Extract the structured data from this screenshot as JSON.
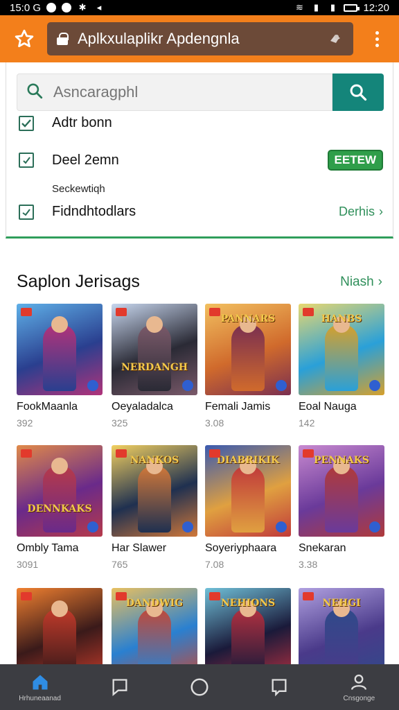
{
  "status_bar": {
    "time": "15:0 G",
    "clock": "12:20"
  },
  "app_bar": {
    "url": "Aplkxulaplikr Apdengnla"
  },
  "search": {
    "placeholder": "Asncaragphl"
  },
  "options": [
    {
      "label": "Adtr bonn"
    },
    {
      "label": "Deel 2emn",
      "badge": "EETEW"
    },
    {
      "label": "Fidndhtodlars",
      "link": "Derhis"
    }
  ],
  "options_small": "Seckewtiqh",
  "section": {
    "title": "Saplon Jerisags",
    "more": "Niash"
  },
  "games": [
    {
      "title": "FookMaanla",
      "num": "392",
      "colors": [
        "#2a3f8f",
        "#b1337a",
        "#5fb0e8"
      ]
    },
    {
      "title": "Oeyaladalca",
      "num": "325",
      "colors": [
        "#2a2a35",
        "#7b5a6a",
        "#c7d6ee"
      ],
      "banner": "NERDANGH"
    },
    {
      "title": "Femali Jamis",
      "num": "3.08",
      "colors": [
        "#d06a2c",
        "#7a2f50",
        "#f2c060"
      ],
      "banner": "PANNARS"
    },
    {
      "title": "Eoal Nauga",
      "num": "142",
      "colors": [
        "#2aa0d8",
        "#d6a02c",
        "#e8d870"
      ],
      "banner": "HANBS"
    },
    {
      "title": "Ombly Tama",
      "num": "3091",
      "colors": [
        "#6a2a8a",
        "#b63a4a",
        "#e08a4a"
      ],
      "banner": "DENNKAKS"
    },
    {
      "title": "Har Slawer",
      "num": "765",
      "colors": [
        "#1f3050",
        "#d0783a",
        "#f2d060"
      ],
      "banner": "NANKOS"
    },
    {
      "title": "Soyeriyphaara",
      "num": "7.08",
      "colors": [
        "#e0a040",
        "#c03a3a",
        "#3a5ab0"
      ],
      "banner": "DIABRIKIK"
    },
    {
      "title": "Snekaran",
      "num": "3.38",
      "colors": [
        "#6a3a9a",
        "#b03a3a",
        "#c88ad0"
      ],
      "banner": "PENNAKS"
    },
    {
      "title": "",
      "num": "",
      "colors": [
        "#3a1a1a",
        "#c03a2a",
        "#f08030"
      ]
    },
    {
      "title": "",
      "num": "",
      "colors": [
        "#2a80d0",
        "#c04a3a",
        "#e8c060"
      ],
      "banner": "DANDWIG"
    },
    {
      "title": "",
      "num": "",
      "colors": [
        "#1a1a3a",
        "#b03040",
        "#70c0d8"
      ],
      "banner": "NEHIONS"
    },
    {
      "title": "",
      "num": "",
      "colors": [
        "#4a3a8a",
        "#304a8a",
        "#b0a0e0"
      ],
      "banner": "NEHGI"
    }
  ],
  "bottom_nav": {
    "home_label": "Hrhuneaanad",
    "profile_label": "Cnsgonge"
  }
}
